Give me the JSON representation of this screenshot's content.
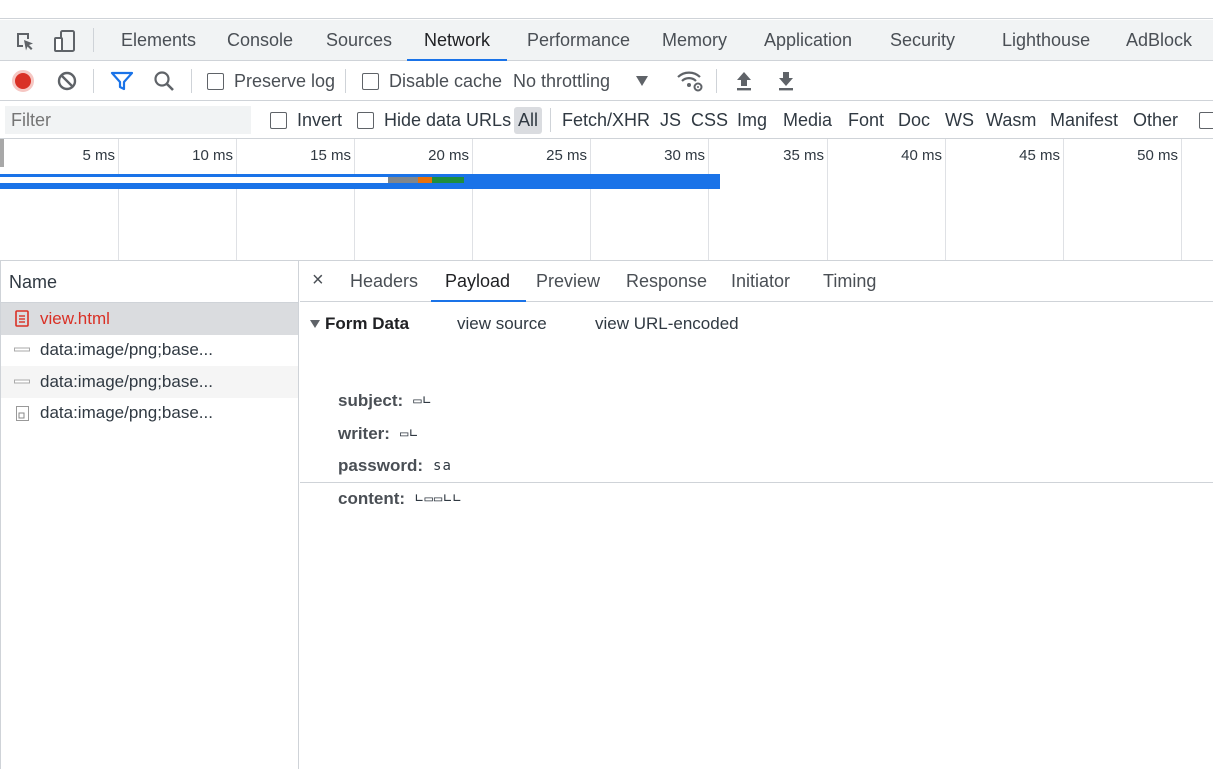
{
  "tabs": [
    "Elements",
    "Console",
    "Sources",
    "Network",
    "Performance",
    "Memory",
    "Application",
    "Security",
    "Lighthouse",
    "AdBlock"
  ],
  "active_tab": "Network",
  "toolbar": {
    "preserve_log": "Preserve log",
    "disable_cache": "Disable cache",
    "throttling": "No throttling"
  },
  "filter": {
    "placeholder": "Filter",
    "invert": "Invert",
    "hide_data_urls": "Hide data URLs",
    "types": [
      "All",
      "Fetch/XHR",
      "JS",
      "CSS",
      "Img",
      "Media",
      "Font",
      "Doc",
      "WS",
      "Wasm",
      "Manifest",
      "Other"
    ],
    "active_type": "All"
  },
  "timeline": {
    "ticks": [
      "5 ms",
      "10 ms",
      "15 ms",
      "20 ms",
      "25 ms",
      "30 ms",
      "35 ms",
      "40 ms",
      "45 ms",
      "50 ms"
    ],
    "colors": {
      "blue": "#1a73e8",
      "gray": "#80868b",
      "orange": "#e8710a",
      "green": "#1e8e3e"
    }
  },
  "requests": {
    "header": "Name",
    "items": [
      {
        "name": "view.html",
        "icon": "document-icon"
      },
      {
        "name": "data:image/png;base...",
        "icon": "image-icon"
      },
      {
        "name": "data:image/png;base...",
        "icon": "image-icon"
      },
      {
        "name": "data:image/png;base...",
        "icon": "file-icon"
      }
    ]
  },
  "detail": {
    "close": "×",
    "tabs": [
      "Headers",
      "Payload",
      "Preview",
      "Response",
      "Initiator",
      "Timing"
    ],
    "active_tab": "Payload",
    "section_title": "Form Data",
    "view_source": "view source",
    "view_url_encoded": "view URL-encoded",
    "form": [
      {
        "key": "subject:",
        "value": "▭∟"
      },
      {
        "key": "writer:",
        "value": "▭∟"
      },
      {
        "key": "password:",
        "value": "sa"
      },
      {
        "key": "content:",
        "value": "∟▭▭∟∟"
      }
    ]
  }
}
